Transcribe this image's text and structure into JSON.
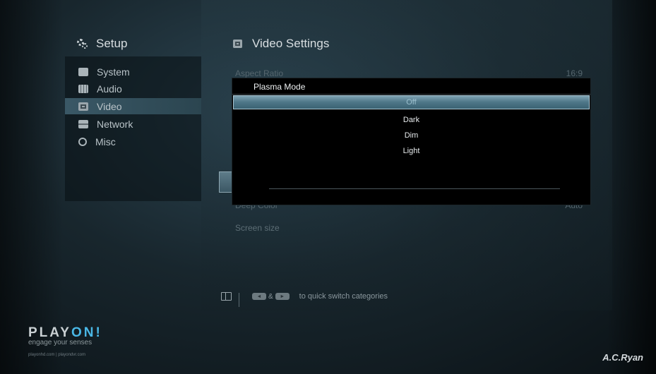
{
  "menu": {
    "header": "Setup",
    "items": [
      {
        "label": "System",
        "icon": "system-icon"
      },
      {
        "label": "Audio",
        "icon": "audio-icon"
      },
      {
        "label": "Video",
        "icon": "video-icon",
        "active": true
      },
      {
        "label": "Network",
        "icon": "network-icon"
      },
      {
        "label": "Misc",
        "icon": "misc-icon"
      }
    ]
  },
  "content": {
    "header": "Video Settings",
    "rows": [
      {
        "label": "Aspect Ratio",
        "value": "16:9"
      },
      {
        "label": "Deep Color",
        "value": "Auto"
      },
      {
        "label": "Screen size",
        "value": ""
      }
    ]
  },
  "popup": {
    "title": "Plasma Mode",
    "options": [
      "Off",
      "Dark",
      "Dim",
      "Light"
    ],
    "selected": "Off"
  },
  "hint": {
    "left_key": "◄",
    "amp": "&",
    "right_key": "►",
    "text": "to quick switch categories"
  },
  "brand": {
    "logo_main": "PLAY",
    "logo_accent": "ON!",
    "tagline": "engage your senses",
    "urls": "playonhd.com | playondvr.com",
    "maker": "A.C.Ryan"
  },
  "colors": {
    "accent": "#4ab8e6",
    "highlight": "#5f8899",
    "popup_bg": "#000000"
  }
}
